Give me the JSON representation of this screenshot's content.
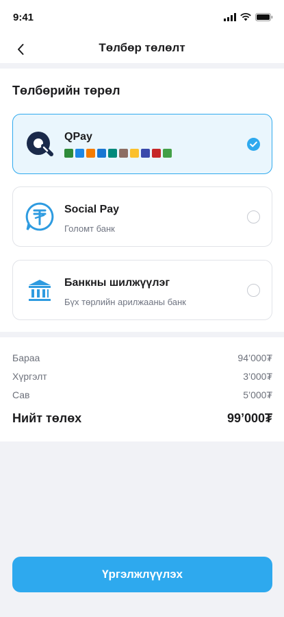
{
  "status": {
    "time": "9:41"
  },
  "nav": {
    "title": "Төлбөр төлөлт"
  },
  "methods": {
    "title": "Төлбөрийн төрөл",
    "options": [
      {
        "name": "QPay",
        "subtitle": "",
        "selected": true,
        "icon": "qpay-logo"
      },
      {
        "name": "Social Pay",
        "subtitle": "Голомт банк",
        "selected": false,
        "icon": "social-pay-logo"
      },
      {
        "name": "Банкны шилжүүлэг",
        "subtitle": "Бүх төрлийн арилжааны банк",
        "selected": false,
        "icon": "bank-building-icon"
      }
    ],
    "qpay_bank_colors": [
      "#2e8b3a",
      "#1e88e5",
      "#f57c00",
      "#1976d2",
      "#00897b",
      "#8d6e63",
      "#fbc02d",
      "#3949ab",
      "#c62828",
      "#43a047"
    ]
  },
  "summary": {
    "rows": [
      {
        "label": "Бараа",
        "value": "94’000₮"
      },
      {
        "label": "Хүргэлт",
        "value": "3’000₮"
      },
      {
        "label": "Сав",
        "value": "5’000₮"
      }
    ],
    "total": {
      "label": "Нийт төлөх",
      "value": "99’000₮"
    }
  },
  "cta": {
    "label": "Үргэлжлүүлэх"
  },
  "colors": {
    "accent": "#2ea9ee",
    "selected_bg": "#eaf6fd"
  }
}
